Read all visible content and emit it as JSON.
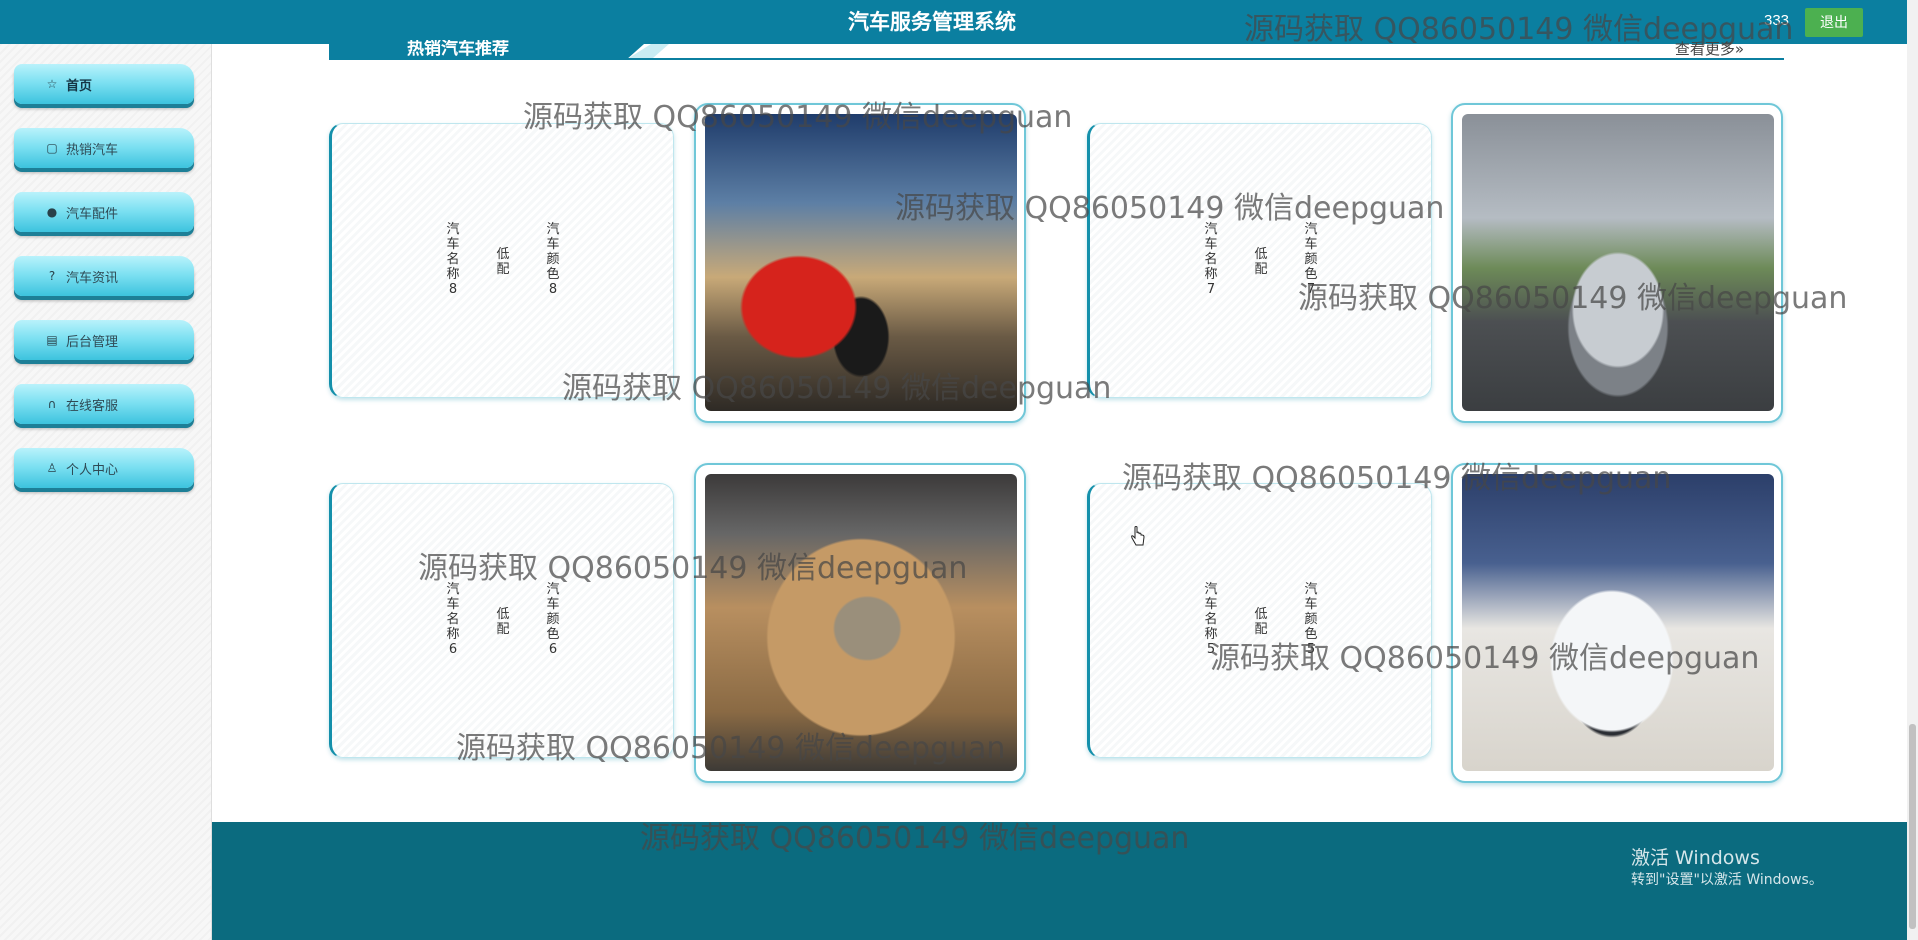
{
  "header": {
    "title": "汽车服务管理系统",
    "username": "333",
    "logout_label": "退出"
  },
  "sidebar": {
    "items": [
      {
        "label": "首页",
        "icon": "star-icon",
        "active": true
      },
      {
        "label": "热销汽车",
        "icon": "bag-icon",
        "active": false
      },
      {
        "label": "汽车配件",
        "icon": "info-icon",
        "active": false
      },
      {
        "label": "汽车资讯",
        "icon": "question-icon",
        "active": false
      },
      {
        "label": "后台管理",
        "icon": "archive-icon",
        "active": false
      },
      {
        "label": "在线客服",
        "icon": "headset-icon",
        "active": false
      },
      {
        "label": "个人中心",
        "icon": "user-icon",
        "active": false
      }
    ]
  },
  "section": {
    "title": "热销汽车推荐",
    "more_label": "查看更多»"
  },
  "cars": [
    {
      "name": "汽车名称8",
      "config": "低配",
      "color": "汽车颜色8",
      "photo": "red-sports-car"
    },
    {
      "name": "汽车名称7",
      "config": "低配",
      "color": "汽车颜色7",
      "photo": "silver-sedan"
    },
    {
      "name": "汽车名称6",
      "config": "低配",
      "color": "汽车颜色6",
      "photo": "gold-luxury-car"
    },
    {
      "name": "汽车名称5",
      "config": "低配",
      "color": "汽车颜色5",
      "photo": "white-suv"
    }
  ],
  "watermark": "源码获取 QQ86050149 微信deepguan",
  "windows_activation": {
    "title": "激活 Windows",
    "subtitle": "转到\"设置\"以激活 Windows。"
  },
  "colors": {
    "primary": "#0b7fa0",
    "footer": "#0b6b7f",
    "logout": "#4cb050"
  }
}
